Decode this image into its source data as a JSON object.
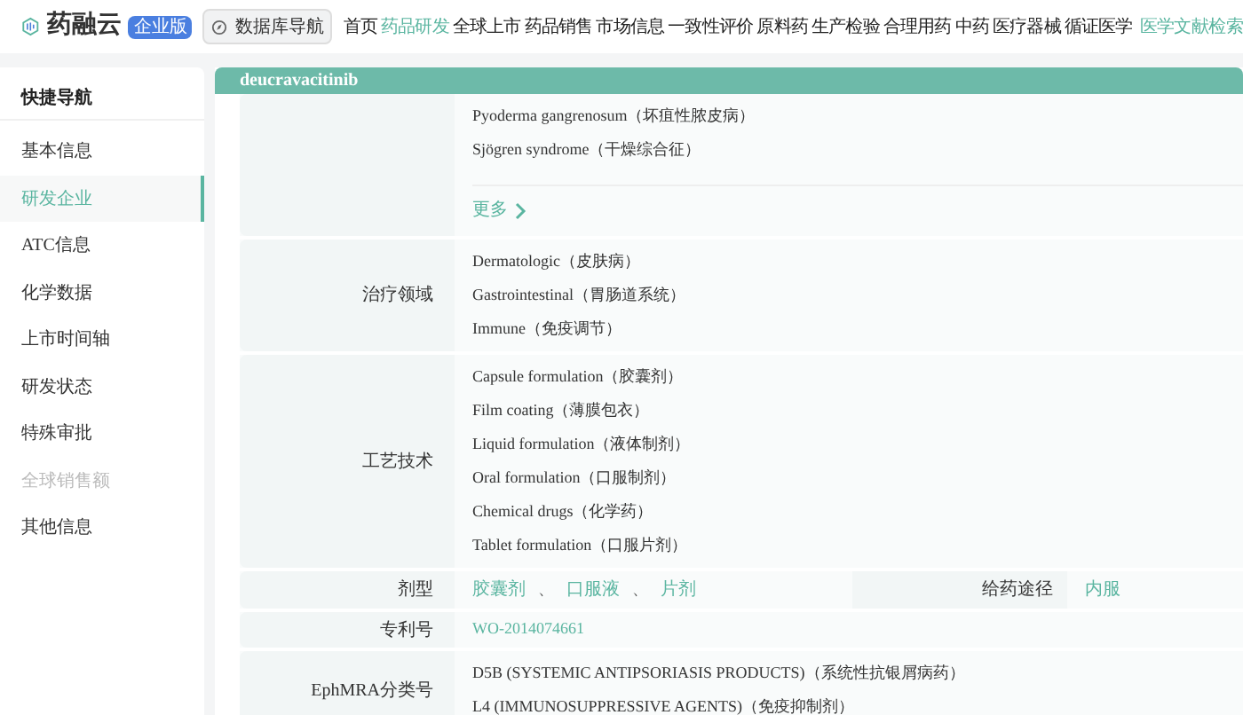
{
  "header": {
    "logo_text": "药融云",
    "edition": "企业版",
    "db_nav": "数据库导航",
    "nav": [
      {
        "label": "首页",
        "selected": false
      },
      {
        "label": "药品研发",
        "selected": true
      },
      {
        "label": "全球上市",
        "selected": false
      },
      {
        "label": "药品销售",
        "selected": false
      },
      {
        "label": "市场信息",
        "selected": false
      },
      {
        "label": "一致性评价",
        "selected": false
      },
      {
        "label": "原料药",
        "selected": false
      },
      {
        "label": "生产检验",
        "selected": false
      },
      {
        "label": "合理用药",
        "selected": false
      },
      {
        "label": "中药",
        "selected": false
      },
      {
        "label": "医疗器械",
        "selected": false
      },
      {
        "label": "循证医学",
        "selected": false
      }
    ],
    "highlight_link": "医学文献检索"
  },
  "sidebar": {
    "title": "快捷导航",
    "items": [
      {
        "label": "基本信息",
        "selected": false,
        "disabled": false
      },
      {
        "label": "研发企业",
        "selected": true,
        "disabled": false
      },
      {
        "label": "ATC信息",
        "selected": false,
        "disabled": false
      },
      {
        "label": "化学数据",
        "selected": false,
        "disabled": false
      },
      {
        "label": "上市时间轴",
        "selected": false,
        "disabled": false
      },
      {
        "label": "研发状态",
        "selected": false,
        "disabled": false
      },
      {
        "label": "特殊审批",
        "selected": false,
        "disabled": false
      },
      {
        "label": "全球销售额",
        "selected": false,
        "disabled": true
      },
      {
        "label": "其他信息",
        "selected": false,
        "disabled": false
      }
    ]
  },
  "panel": {
    "title": "deucravacitinib",
    "rows": [
      {
        "kind": "list",
        "values": [
          "Pyoderma gangrenosum（坏疽性脓皮病）",
          "Sjögren syndrome（干燥综合征）"
        ],
        "more": "更多"
      },
      {
        "kind": "list",
        "label": "治疗领域",
        "values": [
          "Dermatologic（皮肤病）",
          "Gastrointestinal（胃肠道系统）",
          "Immune（免疫调节）"
        ]
      },
      {
        "kind": "list",
        "label": "工艺技术",
        "values": [
          "Capsule formulation（胶囊剂）",
          "Film coating（薄膜包衣）",
          "Liquid formulation（液体制剂）",
          "Oral formulation（口服制剂）",
          "Chemical drugs（化学药）",
          "Tablet formulation（口服片剂）"
        ]
      },
      {
        "kind": "split",
        "label": "剂型",
        "links": [
          "胶囊剂",
          "口服液",
          "片剂"
        ],
        "separator": "、",
        "label2": "给药途径",
        "value2": "内服"
      },
      {
        "kind": "link",
        "label": "专利号",
        "value": "WO-2014074661"
      },
      {
        "kind": "list",
        "label": "EphMRA分类号",
        "values": [
          "D5B (SYSTEMIC ANTIPSORIASIS PRODUCTS)（系统性抗银屑病药）",
          "L4 (IMMUNOSUPPRESSIVE AGENTS)（免疫抑制剂）"
        ]
      }
    ]
  }
}
